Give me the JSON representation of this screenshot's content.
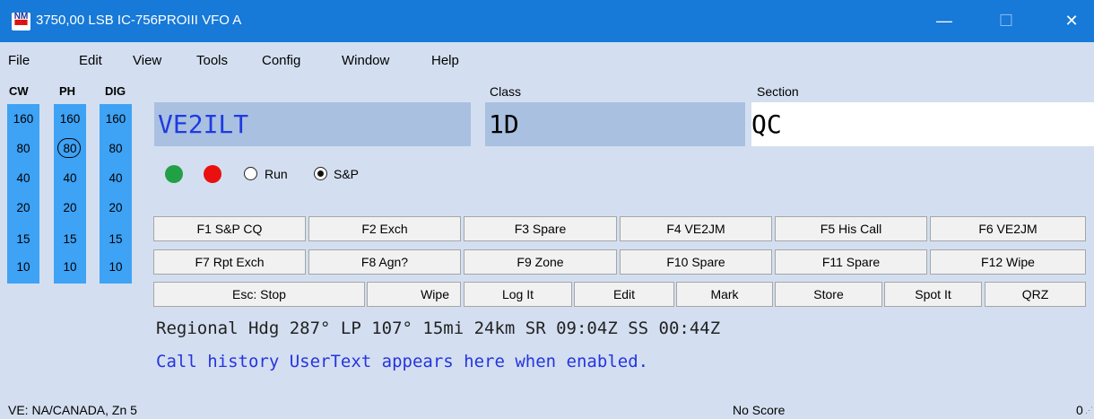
{
  "window": {
    "title": "3750,00 LSB IC-756PROIII VFO A",
    "logo": "NM"
  },
  "window_controls": {
    "minimize": "—",
    "maximize": "☐",
    "close": "✕"
  },
  "menu": [
    "File",
    "Edit",
    "View",
    "Tools",
    "Config",
    "Window",
    "Help"
  ],
  "bands": {
    "headers": [
      "CW",
      "PH",
      "DIG"
    ],
    "list": [
      "160",
      "80",
      "40",
      "20",
      "15",
      "10"
    ],
    "selected": {
      "column": "PH",
      "band": "80"
    }
  },
  "entry": {
    "call_label": "",
    "call": "VE2ILT",
    "class_label": "Class",
    "class": "1D",
    "section_label": "Section",
    "section": "QC"
  },
  "mode": {
    "options": [
      "Run",
      "S&P"
    ],
    "selected": "S&P"
  },
  "fkeys": {
    "row1": [
      "F1 S&P CQ",
      "F2 Exch",
      "F3 Spare",
      "F4 VE2JM",
      "F5 His Call",
      "F6 VE2JM"
    ],
    "row2": [
      "F7 Rpt Exch",
      "F8 Agn?",
      "F9 Zone",
      "F10 Spare",
      "F11 Spare",
      "F12 Wipe"
    ],
    "row3": [
      "Esc: Stop",
      "Wipe",
      "Log It",
      "Edit",
      "Mark",
      "Store",
      "Spot It",
      "QRZ"
    ]
  },
  "info": {
    "bearing_line": "Regional Hdg 287° LP 107° 15mi 24km SR 09:04Z SS 00:44Z",
    "user_text": "Call history UserText appears here when enabled."
  },
  "status": {
    "left": "VE: NA/CANADA, Zn 5",
    "center": "No Score",
    "right": "0"
  },
  "colors": {
    "title_bar": "#1779d8",
    "background": "#d3dff0",
    "band_column": "#3ea2f5",
    "entry_inactive": "#a9c0e0",
    "callsign_text": "#1f3ae0",
    "user_text": "#2634e0",
    "green_led": "#22a046",
    "red_led": "#ea1010"
  }
}
